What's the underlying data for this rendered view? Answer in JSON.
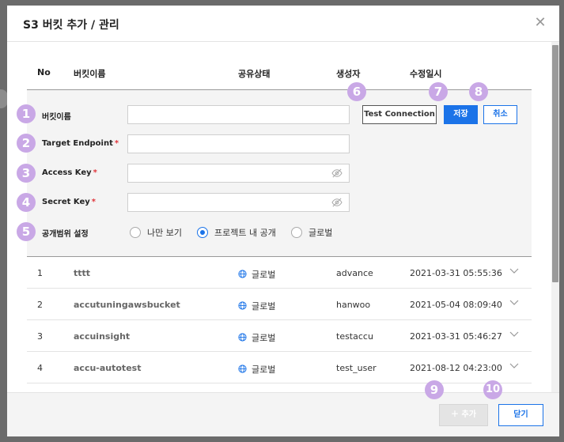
{
  "modal": {
    "title": "S3 버킷 추가 / 관리",
    "close_icon": "close-icon"
  },
  "table": {
    "headers": {
      "no": "No",
      "name": "버킷이름",
      "share": "공유상태",
      "creator": "생성자",
      "modified": "수정일시"
    },
    "rows": [
      {
        "no": "1",
        "name": "tttt",
        "share": "글로벌",
        "creator": "advance",
        "modified": "2021-03-31 05:55:36"
      },
      {
        "no": "2",
        "name": "accutuningawsbucket",
        "share": "글로벌",
        "creator": "hanwoo",
        "modified": "2021-05-04 08:09:40"
      },
      {
        "no": "3",
        "name": "accuinsight",
        "share": "글로벌",
        "creator": "testaccu",
        "modified": "2021-03-31 05:46:27"
      },
      {
        "no": "4",
        "name": "accu-autotest",
        "share": "글로벌",
        "creator": "test_user",
        "modified": "2021-08-12 04:23:00"
      }
    ]
  },
  "form": {
    "bucket_name_label": "버킷이름",
    "target_endpoint_label": "Target Endpoint",
    "access_key_label": "Access Key",
    "secret_key_label": "Secret Key",
    "scope_label": "공개범위 설정",
    "required_mark": "*",
    "bucket_name_value": "",
    "target_endpoint_value": "",
    "access_key_value": "",
    "secret_key_value": "",
    "test_connection_label": "Test Connection",
    "save_label": "저장",
    "cancel_label": "취소",
    "scope_options": [
      {
        "label": "나만 보기",
        "checked": false
      },
      {
        "label": "프로젝트 내 공개",
        "checked": true
      },
      {
        "label": "글로벌",
        "checked": false
      }
    ]
  },
  "footer": {
    "add_label": "＋ 추가",
    "close_label": "닫기"
  },
  "badges": [
    "1",
    "2",
    "3",
    "4",
    "5",
    "6",
    "7",
    "8",
    "9",
    "10"
  ],
  "colors": {
    "primary": "#1b73e8",
    "badge": "#c9a8e6",
    "required": "#e0353b"
  }
}
